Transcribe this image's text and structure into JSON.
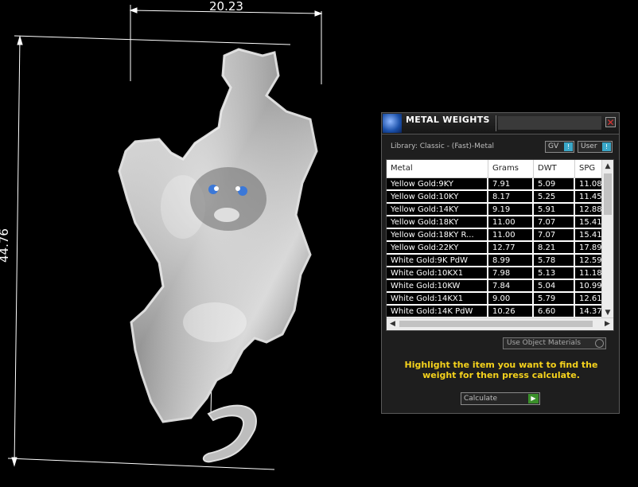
{
  "viewport": {
    "dimension_width": "20.23",
    "dimension_height": "44.76"
  },
  "panel": {
    "title": "METAL WEIGHTS",
    "close_glyph": "✕",
    "library_label": "Library: Classic - (Fast)-Metal",
    "toggle_gv": "GV",
    "toggle_user": "User",
    "table": {
      "columns": [
        "Metal",
        "Grams",
        "DWT",
        "SPG"
      ],
      "rows": [
        [
          "Yellow Gold:9KY",
          "7.91",
          "5.09",
          "11.08"
        ],
        [
          "Yellow Gold:10KY",
          "8.17",
          "5.25",
          "11.45"
        ],
        [
          "Yellow Gold:14KY",
          "9.19",
          "5.91",
          "12.88"
        ],
        [
          "Yellow Gold:18KY",
          "11.00",
          "7.07",
          "15.41"
        ],
        [
          "Yellow Gold:18KY R...",
          "11.00",
          "7.07",
          "15.41"
        ],
        [
          "Yellow Gold:22KY",
          "12.77",
          "8.21",
          "17.89"
        ],
        [
          "White Gold:9K PdW",
          "8.99",
          "5.78",
          "12.59"
        ],
        [
          "White Gold:10KX1",
          "7.98",
          "5.13",
          "11.18"
        ],
        [
          "White Gold:10KW",
          "7.84",
          "5.04",
          "10.99"
        ],
        [
          "White Gold:14KX1",
          "9.00",
          "5.79",
          "12.61"
        ],
        [
          "White Gold:14K PdW",
          "10.26",
          "6.60",
          "14.37"
        ]
      ]
    },
    "use_object_materials": "Use Object Materials",
    "hint": "Highlight the item you want to find the weight for then press calculate.",
    "calculate_label": "Calculate"
  }
}
